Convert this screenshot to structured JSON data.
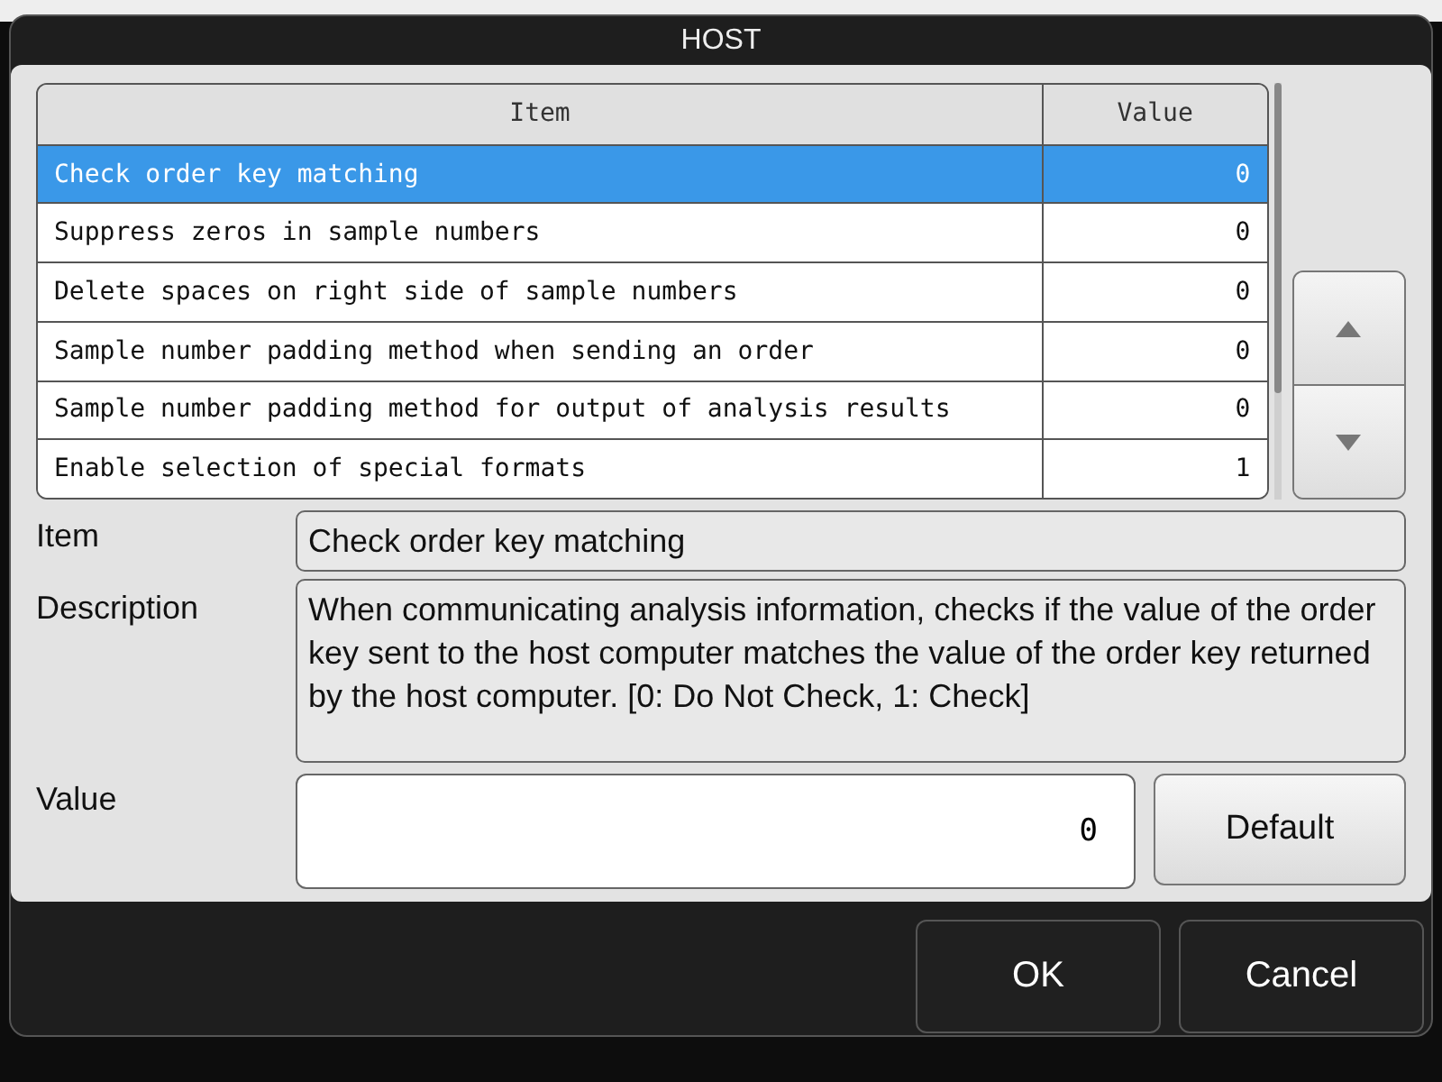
{
  "dialog": {
    "title": "HOST"
  },
  "table": {
    "columns": [
      "Item",
      "Value"
    ],
    "rows": [
      {
        "item": "Check order key matching",
        "value": "0",
        "selected": true
      },
      {
        "item": "Suppress zeros in sample numbers",
        "value": "0",
        "selected": false
      },
      {
        "item": "Delete spaces on right side of sample numbers",
        "value": "0",
        "selected": false
      },
      {
        "item": "Sample number padding method when sending an order",
        "value": "0",
        "selected": false
      },
      {
        "item": "Sample number padding method for output of analysis results",
        "value": "0",
        "selected": false
      },
      {
        "item": "Enable selection of special formats",
        "value": "1",
        "selected": false
      }
    ]
  },
  "detail": {
    "item_label": "Item",
    "item_value": "Check order key matching",
    "description_label": "Description",
    "description": "When communicating analysis information, checks if the value of the order key sent to the host computer matches the value of the order key returned by the host computer. [0: Do Not Check, 1: Check]",
    "value_label": "Value",
    "value": "0",
    "default_button": "Default"
  },
  "buttons": [
    "OK",
    "Cancel"
  ]
}
